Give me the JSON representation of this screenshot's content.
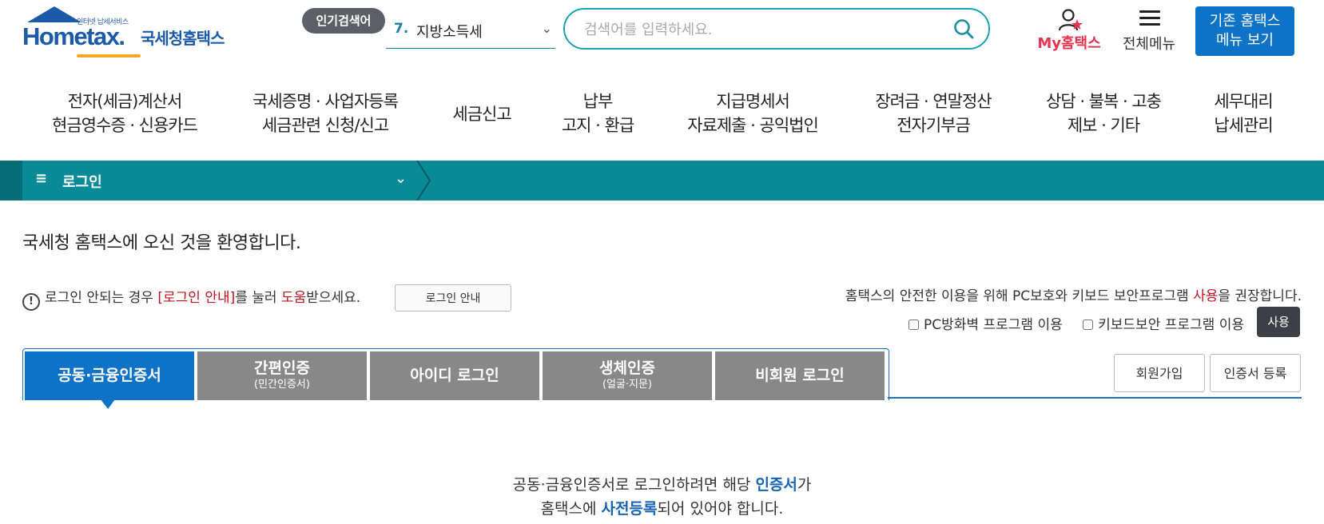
{
  "logo": {
    "small_text": "인터넷 납세서비스",
    "brand": "Hometax.",
    "brand_sub": "국세청홈택스"
  },
  "header": {
    "popular_badge": "인기검색어",
    "popular_rank": "7.",
    "popular_term": "지방소득세",
    "search_placeholder": "검색어를 입력하세요.",
    "my_hometax": "My홈택스",
    "all_menu": "전체메뉴",
    "legacy_line1": "기존 홈택스",
    "legacy_line2": "메뉴 보기"
  },
  "nav": [
    {
      "line1": "전자(세금)계산서",
      "line2": "현금영수증 · 신용카드"
    },
    {
      "line1": "국세증명 · 사업자등록",
      "line2": "세금관련 신청/신고"
    },
    {
      "line1": "세금신고",
      "line2": ""
    },
    {
      "line1": "납부",
      "line2": "고지 · 환급"
    },
    {
      "line1": "지급명세서",
      "line2": "자료제출 · 공익법인"
    },
    {
      "line1": "장려금 · 연말정산",
      "line2": "전자기부금"
    },
    {
      "line1": "상담 · 불복 · 고충",
      "line2": "제보 · 기타"
    },
    {
      "line1": "세무대리",
      "line2": "납세관리"
    }
  ],
  "location": {
    "menu_glyph": "≡",
    "title": "로그인"
  },
  "welcome": "국세청 홈택스에 오신 것을 환영합니다.",
  "notice": {
    "prefix": "로그인 안되는 경우 ",
    "link_text": "[로그인 안내]",
    "middle": "를 눌러 ",
    "help": "도움",
    "suffix": "받으세요.",
    "button": "로그인 안내"
  },
  "recommend": {
    "prefix": "홈택스의 안전한 이용을 위해 PC보호와 키보드 보안프로그램 ",
    "use_word": "사용",
    "suffix": "을 권장합니다.",
    "pc_firewall": "PC방화벽 프로그램 이용",
    "keyboard_security": "키보드보안 프로그램 이용",
    "use_button": "사용"
  },
  "tabs": [
    {
      "label": "공동·금융인증서",
      "sub": ""
    },
    {
      "label": "간편인증",
      "sub": "(민간인증서)"
    },
    {
      "label": "아이디 로그인",
      "sub": ""
    },
    {
      "label": "생체인증",
      "sub": "(얼굴·지문)"
    },
    {
      "label": "비회원 로그인",
      "sub": ""
    }
  ],
  "actions": {
    "join": "회원가입",
    "cert_register": "인증서 등록"
  },
  "info": {
    "line1_prefix": "공동·금융인증서로 로그인하려면 해당 ",
    "line1_bold": "인증서",
    "line1_suffix": "가",
    "line2_prefix": "홈택스에 ",
    "line2_bold": "사전등록",
    "line2_suffix": "되어 있어야 합니다."
  },
  "colors": {
    "teal": "#088b96",
    "blue": "#0e73c6",
    "red": "#c1121f",
    "pink": "#e5344f"
  }
}
